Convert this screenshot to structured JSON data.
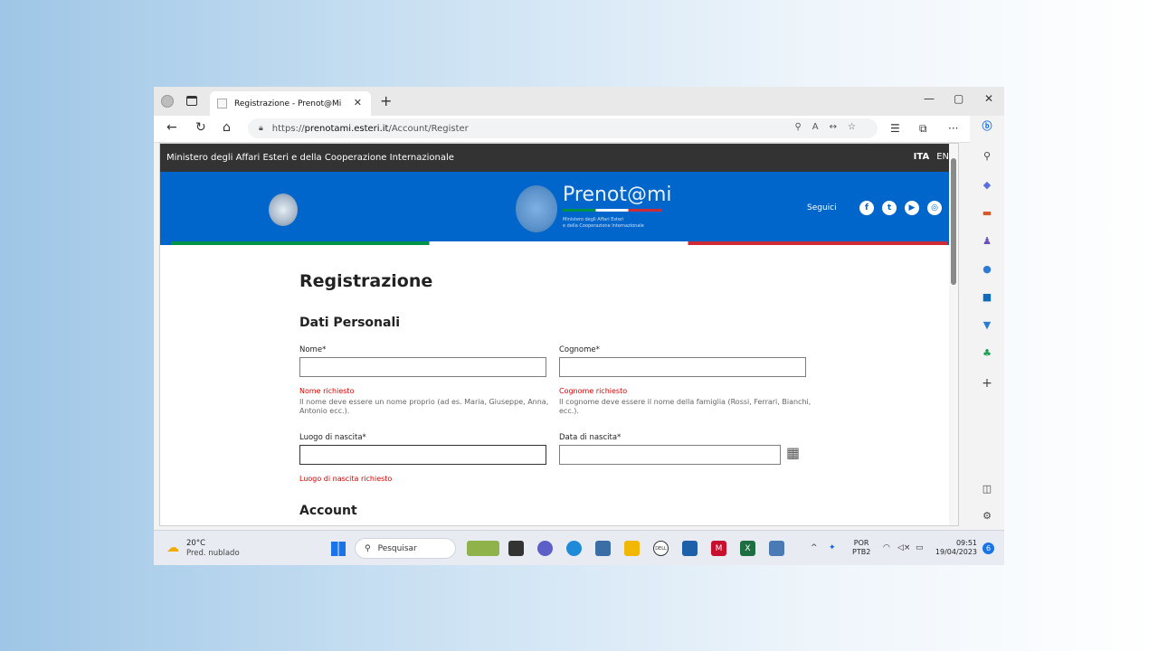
{
  "browser": {
    "tab_title": "Registrazione - Prenot@Mi",
    "tab_close": "✕",
    "new_tab": "+",
    "url_prefix": "https://",
    "url_domain": "prenotami.esteri.it",
    "url_path": "/Account/Register",
    "win_minimize": "—",
    "win_maximize": "▢",
    "win_close": "✕"
  },
  "site": {
    "ministry_name": "Ministero degli Affari Esteri e della Cooperazione Internazionale",
    "lang_ita": "ITA",
    "lang_en": "EN",
    "brand": "Prenot@mi",
    "brand_sub_1": "Ministero degli Affari Esteri",
    "brand_sub_2": "e della Cooperazione Internazionale",
    "follow_label": "Seguici",
    "social": [
      "f",
      "t",
      "▶",
      "◎"
    ]
  },
  "form": {
    "title": "Registrazione",
    "section_personal": "Dati Personali",
    "section_account": "Account",
    "first_name_label": "Nome*",
    "first_name_error": "Nome richiesto",
    "first_name_hint": "Il nome deve essere un nome proprio (ad es. Maria, Giuseppe, Anna, Antonio ecc.).",
    "last_name_label": "Cognome*",
    "last_name_error": "Cognome richiesto",
    "last_name_hint": "Il cognome deve essere il nome della famiglia (Rossi, Ferrari, Bianchi, ecc.).",
    "birthplace_label": "Luogo di nascita*",
    "birthplace_error": "Luogo di nascita richiesto",
    "birthdate_label": "Data di nascita*"
  },
  "taskbar": {
    "temperature": "20°C",
    "weather": "Pred. nublado",
    "search_placeholder": "Pesquisar",
    "lang_1": "POR",
    "lang_2": "PTB2",
    "time": "09:51",
    "date": "19/04/2023",
    "notification_count": "6"
  },
  "colors": {
    "banner": "#0066cc",
    "topbar": "#333333",
    "error": "#dd0000",
    "accent": "#1a73e8"
  }
}
